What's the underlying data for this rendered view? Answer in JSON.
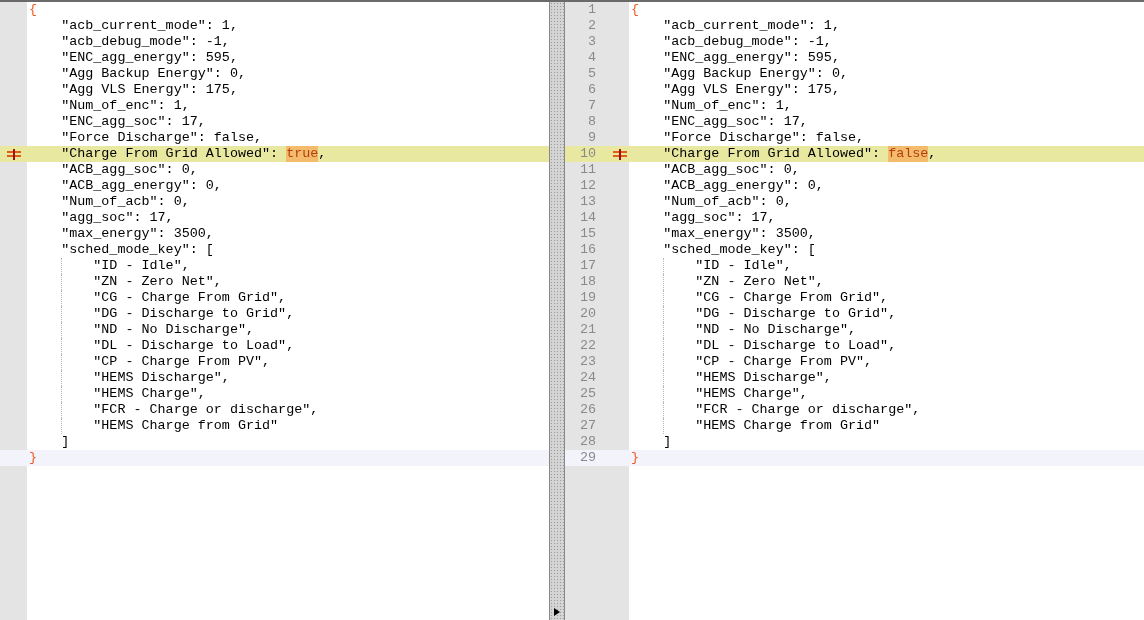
{
  "panes": [
    {
      "line_numbers": false,
      "lines": [
        {
          "kind": "brace",
          "text": "{",
          "current": false
        },
        {
          "kind": "key",
          "text": "    \"acb_current_mode\": 1,",
          "current": false
        },
        {
          "kind": "key",
          "text": "    \"acb_debug_mode\": -1,",
          "current": false
        },
        {
          "kind": "key",
          "text": "    \"ENC_agg_energy\": 595,",
          "current": false
        },
        {
          "kind": "key",
          "text": "    \"Agg Backup Energy\": 0,",
          "current": false
        },
        {
          "kind": "key",
          "text": "    \"Agg VLS Energy\": 175,",
          "current": false
        },
        {
          "kind": "key",
          "text": "    \"Num_of_enc\": 1,",
          "current": false
        },
        {
          "kind": "key",
          "text": "    \"ENC_agg_soc\": 17,",
          "current": false
        },
        {
          "kind": "key",
          "text": "    \"Force Discharge\": false,",
          "current": false
        },
        {
          "kind": "changed",
          "text": "    \"Charge From Grid Allowed\": ",
          "token": "true",
          "after": ",",
          "current": false
        },
        {
          "kind": "key",
          "text": "    \"ACB_agg_soc\": 0,",
          "current": false
        },
        {
          "kind": "key",
          "text": "    \"ACB_agg_energy\": 0,",
          "current": false
        },
        {
          "kind": "key",
          "text": "    \"Num_of_acb\": 0,",
          "current": false
        },
        {
          "kind": "key",
          "text": "    \"agg_soc\": 17,",
          "current": false
        },
        {
          "kind": "key",
          "text": "    \"max_energy\": 3500,",
          "current": false
        },
        {
          "kind": "key",
          "text": "    \"sched_mode_key\": [",
          "current": false
        },
        {
          "kind": "item",
          "text": "        \"ID - Idle\",",
          "current": false
        },
        {
          "kind": "item",
          "text": "        \"ZN - Zero Net\",",
          "current": false
        },
        {
          "kind": "item",
          "text": "        \"CG - Charge From Grid\",",
          "current": false
        },
        {
          "kind": "item",
          "text": "        \"DG - Discharge to Grid\",",
          "current": false
        },
        {
          "kind": "item",
          "text": "        \"ND - No Discharge\",",
          "current": false
        },
        {
          "kind": "item",
          "text": "        \"DL - Discharge to Load\",",
          "current": false
        },
        {
          "kind": "item",
          "text": "        \"CP - Charge From PV\",",
          "current": false
        },
        {
          "kind": "item",
          "text": "        \"HEMS Discharge\",",
          "current": false
        },
        {
          "kind": "item",
          "text": "        \"HEMS Charge\",",
          "current": false
        },
        {
          "kind": "item",
          "text": "        \"FCR - Charge or discharge\",",
          "current": false
        },
        {
          "kind": "item",
          "text": "        \"HEMS Charge from Grid\"",
          "current": false
        },
        {
          "kind": "key",
          "text": "    ]",
          "current": false
        },
        {
          "kind": "brace",
          "text": "}",
          "current": true
        }
      ]
    },
    {
      "line_numbers": true,
      "lines": [
        {
          "number": "1",
          "kind": "brace",
          "text": "{",
          "current": false
        },
        {
          "number": "2",
          "kind": "key",
          "text": "    \"acb_current_mode\": 1,",
          "current": false
        },
        {
          "number": "3",
          "kind": "key",
          "text": "    \"acb_debug_mode\": -1,",
          "current": false
        },
        {
          "number": "4",
          "kind": "key",
          "text": "    \"ENC_agg_energy\": 595,",
          "current": false
        },
        {
          "number": "5",
          "kind": "key",
          "text": "    \"Agg Backup Energy\": 0,",
          "current": false
        },
        {
          "number": "6",
          "kind": "key",
          "text": "    \"Agg VLS Energy\": 175,",
          "current": false
        },
        {
          "number": "7",
          "kind": "key",
          "text": "    \"Num_of_enc\": 1,",
          "current": false
        },
        {
          "number": "8",
          "kind": "key",
          "text": "    \"ENC_agg_soc\": 17,",
          "current": false
        },
        {
          "number": "9",
          "kind": "key",
          "text": "    \"Force Discharge\": false,",
          "current": false
        },
        {
          "number": "10",
          "kind": "changed",
          "text": "    \"Charge From Grid Allowed\": ",
          "token": "false",
          "after": ",",
          "current": false
        },
        {
          "number": "11",
          "kind": "key",
          "text": "    \"ACB_agg_soc\": 0,",
          "current": false
        },
        {
          "number": "12",
          "kind": "key",
          "text": "    \"ACB_agg_energy\": 0,",
          "current": false
        },
        {
          "number": "13",
          "kind": "key",
          "text": "    \"Num_of_acb\": 0,",
          "current": false
        },
        {
          "number": "14",
          "kind": "key",
          "text": "    \"agg_soc\": 17,",
          "current": false
        },
        {
          "number": "15",
          "kind": "key",
          "text": "    \"max_energy\": 3500,",
          "current": false
        },
        {
          "number": "16",
          "kind": "key",
          "text": "    \"sched_mode_key\": [",
          "current": false
        },
        {
          "number": "17",
          "kind": "item",
          "text": "        \"ID - Idle\",",
          "current": false
        },
        {
          "number": "18",
          "kind": "item",
          "text": "        \"ZN - Zero Net\",",
          "current": false
        },
        {
          "number": "19",
          "kind": "item",
          "text": "        \"CG - Charge From Grid\",",
          "current": false
        },
        {
          "number": "20",
          "kind": "item",
          "text": "        \"DG - Discharge to Grid\",",
          "current": false
        },
        {
          "number": "21",
          "kind": "item",
          "text": "        \"ND - No Discharge\",",
          "current": false
        },
        {
          "number": "22",
          "kind": "item",
          "text": "        \"DL - Discharge to Load\",",
          "current": false
        },
        {
          "number": "23",
          "kind": "item",
          "text": "        \"CP - Charge From PV\",",
          "current": false
        },
        {
          "number": "24",
          "kind": "item",
          "text": "        \"HEMS Discharge\",",
          "current": false
        },
        {
          "number": "25",
          "kind": "item",
          "text": "        \"HEMS Charge\",",
          "current": false
        },
        {
          "number": "26",
          "kind": "item",
          "text": "        \"FCR - Charge or discharge\",",
          "current": false
        },
        {
          "number": "27",
          "kind": "item",
          "text": "        \"HEMS Charge from Grid\"",
          "current": false
        },
        {
          "number": "28",
          "kind": "key",
          "text": "    ]",
          "current": false
        },
        {
          "number": "29",
          "kind": "brace",
          "text": "}",
          "current": true
        }
      ]
    }
  ]
}
